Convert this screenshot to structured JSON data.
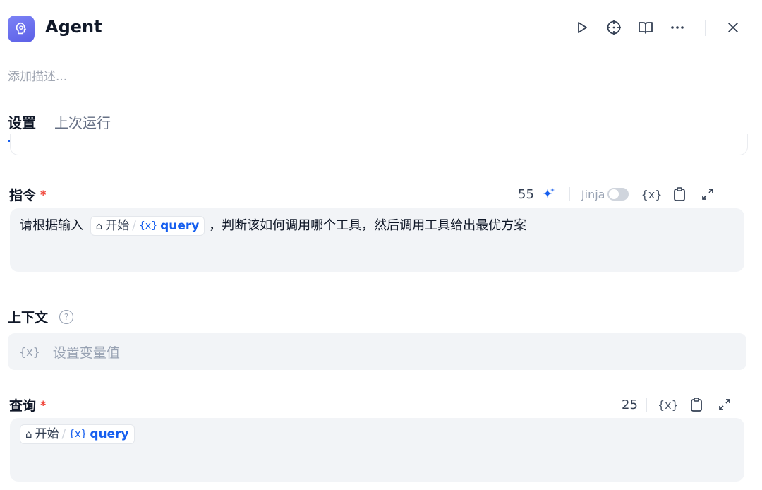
{
  "header": {
    "app_icon": "agent-brain-icon",
    "title": "Agent",
    "actions": [
      "play-icon",
      "locate-icon",
      "book-icon",
      "more-icon",
      "close-icon"
    ]
  },
  "description_placeholder": "添加描述...",
  "tabs": [
    {
      "label": "设置",
      "active": true
    },
    {
      "label": "上次运行",
      "active": false
    }
  ],
  "instruction": {
    "label": "指令",
    "required_mark": "*",
    "count": "55",
    "jinja_label": "Jinja",
    "jinja_enabled": false,
    "text_before": "请根据输入",
    "chip": {
      "node": "开始",
      "sep": "/",
      "x_icon": "{x}",
      "var": "query"
    },
    "text_after": "，判断该如何调用哪个工具，然后调用工具给出最优方案"
  },
  "context": {
    "label": "上下文",
    "help": "?",
    "x_icon": "{x}",
    "placeholder": "设置变量值"
  },
  "query": {
    "label": "查询",
    "required_mark": "*",
    "count": "25",
    "chip": {
      "node": "开始",
      "sep": "/",
      "x_icon": "{x}",
      "var": "query"
    }
  },
  "colors": {
    "accent": "#155eef",
    "required": "#f04438",
    "editor_bg": "#f2f4f7",
    "app_icon": "#6366f1"
  }
}
